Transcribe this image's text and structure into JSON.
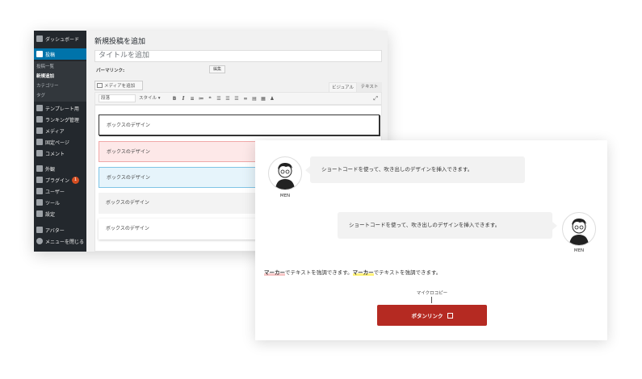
{
  "sidebar": {
    "dashboard": "ダッシュボード",
    "posts": "投稿",
    "posts_sub": [
      "投稿一覧",
      "新規追加",
      "カテゴリー",
      "タグ"
    ],
    "items": [
      "テンプレート用",
      "ランキング管理",
      "メディア",
      "固定ページ",
      "コメント",
      "外観",
      "プラグイン",
      "ユーザー",
      "ツール",
      "設定",
      "アバター",
      "メニューを閉じる"
    ],
    "plugin_badge": "1"
  },
  "editor": {
    "page_title": "新規投稿を追加",
    "title_placeholder": "タイトルを追加",
    "permalink_label": "パーマリンク:",
    "permalink_edit": "編集",
    "media_button": "メディアを追加",
    "tab_visual": "ビジュアル",
    "tab_text": "テキスト",
    "format_select": "段落",
    "style_select": "スタイル ▾",
    "toolbar_icons": [
      "bold-icon",
      "italic-icon",
      "bullet-list-icon",
      "numbered-list-icon",
      "quote-icon",
      "align-left-icon",
      "align-center-icon",
      "align-right-icon",
      "link-icon",
      "toolbar-toggle-icon",
      "table-icon",
      "shortcode-icon",
      "fullscreen-icon"
    ],
    "boxes": [
      "ボックスのデザイン",
      "ボックスのデザイン",
      "ボックスのデザイン",
      "ボックスのデザイン",
      "ボックスのデザイン"
    ]
  },
  "preview": {
    "bubble_left_text": "ショートコードを使って、吹き出しのデザインを挿入できます。",
    "bubble_right_text": "ショートコードを使って、吹き出しのデザインを挿入できます。",
    "avatar_label": "MEN",
    "marker_word": "マーカー",
    "marker_rest": "でテキストを強調できます。",
    "microcopy": "マイクロコピー",
    "cta_label": "ボタンリンク"
  },
  "colors": {
    "sidebar_bg": "#23282d",
    "sidebar_active": "#0073aa",
    "cta": "#b52a22",
    "marker_red": "#f6c6c6",
    "marker_yellow": "#fff27a"
  }
}
